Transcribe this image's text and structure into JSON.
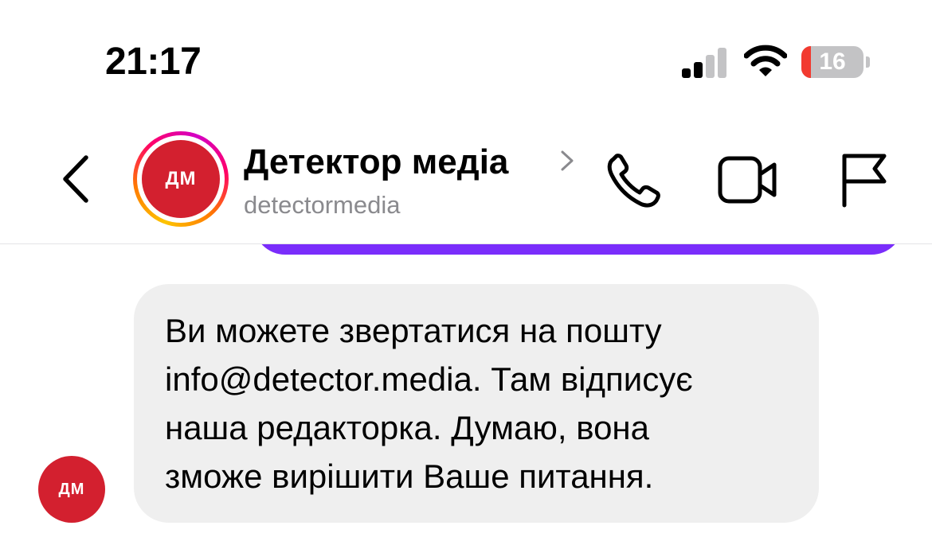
{
  "status_bar": {
    "time": "21:17",
    "battery_level": "16",
    "battery_fraction": 0.16,
    "signal_bars_active": 2,
    "signal_bars_total": 4
  },
  "header": {
    "avatar_initials": "ДМ",
    "contact_name": "Детектор медіа",
    "username": "detectormedia",
    "icons": [
      "back-chevron-icon",
      "phone-icon",
      "video-camera-icon",
      "flag-icon"
    ]
  },
  "conversation": {
    "sender_avatar_initials": "ДМ",
    "message_lines": [
      "Ви можете звертатися на пошту",
      "info@detector.media. Там відписує",
      "наша редакторка. Думаю, вона",
      "зможе вирішити Ваше питання."
    ]
  },
  "colors": {
    "brand_red": "#d3202f",
    "sent_bubble": "#7a2dfb",
    "received_bubble": "#efefef",
    "secondary_text": "#8a8a8e",
    "battery_low": "#f23a30"
  }
}
